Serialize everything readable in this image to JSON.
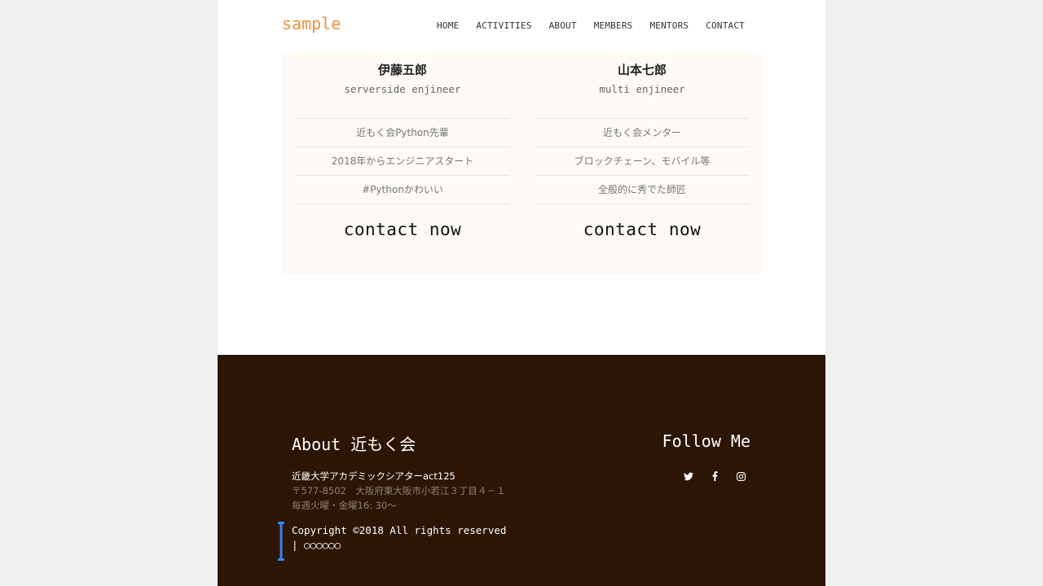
{
  "header": {
    "logo": "sample",
    "nav": [
      "HOME",
      "ACTIVITIES",
      "ABOUT",
      "MEMBERS",
      "MENTORS",
      "CONTACT"
    ]
  },
  "members": [
    {
      "name": "伊藤五郎",
      "role": "serverside enjineer",
      "details": [
        "近もく会Python先輩",
        "2018年からエンジニアスタート",
        "#Pythonかわいい"
      ],
      "contact": "contact now"
    },
    {
      "name": "山本七郎",
      "role": "multi enjineer",
      "details": [
        "近もく会メンター",
        "ブロックチェーン、モバイル等",
        "全般的に秀でた師匠"
      ],
      "contact": "contact now"
    }
  ],
  "footer": {
    "about_title": "About 近もく会",
    "address_line1": "近畿大学アカデミックシアターact125",
    "address_line2": "〒577-8502　大阪府東大阪市小若江３丁目４－１",
    "address_line3": "毎週火曜・金曜16: 30〜",
    "follow_title": "Follow Me",
    "social_icons": [
      "twitter-icon",
      "facebook-icon",
      "instagram-icon"
    ],
    "copyright_line1": "Copyright ©2018 All rights reserved",
    "copyright_line2": "| ○○○○○○"
  },
  "colors": {
    "logo": "#ef8f3e",
    "footer_bg": "#2c1503",
    "card_bg": "#fdfaf5",
    "cursor_accent": "#3b82f6"
  }
}
